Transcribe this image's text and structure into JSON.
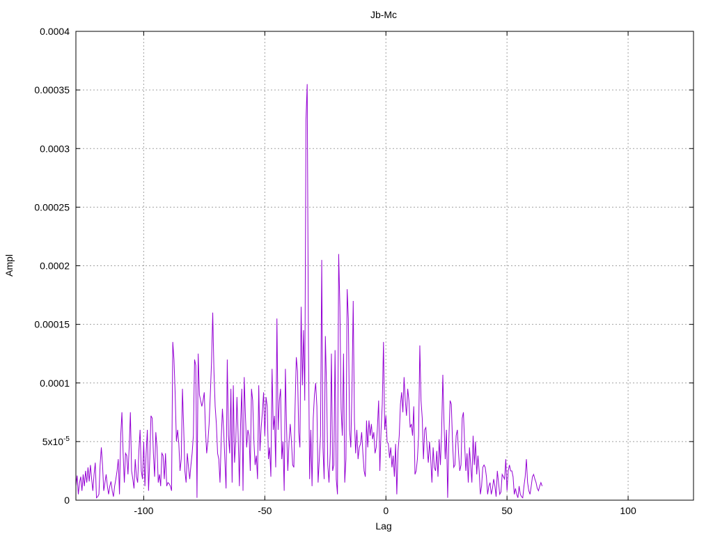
{
  "chart_data": {
    "type": "line",
    "title": "Jb-Mc",
    "xlabel": "Lag",
    "ylabel": "Ampl",
    "xlim": [
      -128,
      127
    ],
    "ylim": [
      0,
      0.0004
    ],
    "grid": true,
    "x_ticks": [
      {
        "value": -100,
        "label": "-100"
      },
      {
        "value": -50,
        "label": "-50"
      },
      {
        "value": 0,
        "label": "0"
      },
      {
        "value": 50,
        "label": "50"
      },
      {
        "value": 100,
        "label": "100"
      }
    ],
    "y_ticks": [
      {
        "value": 0,
        "label": "0"
      },
      {
        "value": 5e-05,
        "label": "5x10",
        "sup": "-5"
      },
      {
        "value": 0.0001,
        "label": "0.0001"
      },
      {
        "value": 0.00015,
        "label": "0.00015"
      },
      {
        "value": 0.0002,
        "label": "0.0002"
      },
      {
        "value": 0.00025,
        "label": "0.00025"
      },
      {
        "value": 0.0003,
        "label": "0.0003"
      },
      {
        "value": 0.00035,
        "label": "0.00035"
      },
      {
        "value": 0.0004,
        "label": "0.0004"
      }
    ],
    "series": [
      {
        "color": "#9400d3",
        "x_start": -128,
        "x_step": 0.5,
        "values": [
          1.2e-05,
          2.1e-05,
          5e-06,
          1.5e-05,
          2e-05,
          8e-06,
          2.2e-05,
          1.2e-05,
          2.5e-05,
          1.5e-05,
          2.8e-05,
          1.6e-05,
          3e-05,
          1.8e-05,
          8e-06,
          2.2e-05,
          3.2e-05,
          2e-06,
          3e-06,
          5e-06,
          3e-05,
          4.5e-05,
          3e-05,
          8e-06,
          1.5e-05,
          2.2e-05,
          1.2e-05,
          5e-06,
          1.2e-05,
          1.6e-05,
          8e-06,
          3e-06,
          1.2e-05,
          1.8e-05,
          2.5e-05,
          3.5e-05,
          5e-06,
          5.5e-05,
          7.5e-05,
          4e-05,
          1.5e-05,
          4e-05,
          3.8e-05,
          2.2e-05,
          4.5e-05,
          7.5e-05,
          2.5e-05,
          1.8e-05,
          1e-05,
          3.5e-05,
          2e-05,
          1.5e-05,
          4.2e-05,
          6e-05,
          2.5e-05,
          1.8e-05,
          5e-05,
          1.2e-05,
          4e-05,
          6e-05,
          8e-06,
          3.5e-05,
          7.2e-05,
          7e-05,
          4e-05,
          2e-05,
          5.8e-05,
          4.5e-05,
          1.5e-05,
          2.2e-05,
          1.2e-05,
          4e-05,
          3.8e-05,
          1.8e-05,
          4e-05,
          1.2e-05,
          1.5e-05,
          1.4e-05,
          1.2e-05,
          8e-06,
          0.000135,
          0.00012,
          9e-05,
          5e-05,
          6e-05,
          4.8e-05,
          2.5e-05,
          3.5e-05,
          9.5e-05,
          6.2e-05,
          2.5e-05,
          1.5e-05,
          4e-05,
          2.8e-05,
          1.8e-05,
          3e-05,
          4e-05,
          5.5e-05,
          0.00012,
          0.000115,
          2e-06,
          0.000125,
          9e-05,
          8.5e-05,
          8e-05,
          8.5e-05,
          9.2e-05,
          6e-05,
          4e-05,
          5e-05,
          6.5e-05,
          9e-05,
          0.000118,
          0.00016,
          0.00011,
          8e-05,
          6.5e-05,
          4e-05,
          3.5e-05,
          1.5e-05,
          5.2e-05,
          7.8e-05,
          6e-05,
          3.5e-05,
          1e-05,
          0.00012,
          5.5e-05,
          4e-05,
          9.5e-05,
          1.5e-05,
          9.8e-05,
          3.2e-05,
          5e-05,
          8.8e-05,
          5.5e-05,
          1.2e-05,
          6.5e-05,
          9.5e-05,
          8e-06,
          0.000105,
          7.2e-05,
          4.5e-05,
          6e-05,
          5.5e-05,
          2.5e-05,
          9.5e-05,
          8.5e-05,
          5e-05,
          3e-05,
          3.8e-05,
          1.8e-05,
          9.8e-05,
          4.2e-05,
          6.2e-05,
          7.5e-05,
          9.2e-05,
          5.5e-05,
          8.8e-05,
          8e-05,
          3.5e-05,
          4.5e-05,
          2e-05,
          0.000112,
          6e-05,
          7.2e-05,
          2.8e-05,
          0.000155,
          6e-05,
          8.5e-05,
          9.5e-05,
          3.5e-05,
          5e-05,
          8e-06,
          0.000112,
          6e-05,
          2.5e-05,
          5e-05,
          6.5e-05,
          5e-05,
          3e-05,
          2.8e-05,
          8e-05,
          0.000122,
          0.00011,
          5.8e-05,
          4.5e-05,
          0.000165,
          9.8e-05,
          0.000145,
          8.5e-05,
          0.000325,
          0.000355,
          0.00014,
          1.8e-05,
          6e-05,
          1.2e-05,
          7e-05,
          9e-05,
          0.0001,
          8e-05,
          1.5e-05,
          3.5e-05,
          5.5e-05,
          0.000205,
          4.5e-05,
          1.8e-05,
          0.00014,
          9.5e-05,
          3e-05,
          1.5e-05,
          4e-05,
          0.000125,
          2.5e-05,
          3e-05,
          0.000128,
          1.8e-05,
          5e-06,
          0.00021,
          0.000165,
          7.8e-05,
          5.5e-05,
          0.000125,
          1.5e-05,
          3.5e-05,
          0.00018,
          0.000155,
          6e-05,
          4.5e-05,
          9.5e-05,
          0.00017,
          6.8e-05,
          4e-05,
          6e-05,
          3.5e-05,
          4.5e-05,
          4.8e-05,
          5.8e-05,
          4e-05,
          2.5e-05,
          2e-05,
          6.8e-05,
          4.5e-05,
          6.8e-05,
          5.5e-05,
          6.5e-05,
          5.2e-05,
          5.8e-05,
          4e-05,
          4.5e-05,
          6.2e-05,
          8.5e-05,
          2.5e-05,
          6e-05,
          8.2e-05,
          0.000135,
          6e-05,
          7.2e-05,
          5e-05,
          4.8e-05,
          3.6e-05,
          4.5e-05,
          2.8e-05,
          3.8e-05,
          2e-05,
          4.8e-05,
          5e-06,
          4.2e-05,
          5.5e-05,
          8.2e-05,
          9.2e-05,
          7.5e-05,
          0.000105,
          8.5e-05,
          7.2e-05,
          9.5e-05,
          8.5e-05,
          6.2e-05,
          6.5e-05,
          5.5e-05,
          8e-05,
          2.2e-05,
          2.5e-05,
          3.5e-05,
          5.5e-05,
          0.000132,
          8.5e-05,
          7e-05,
          3.5e-05,
          6e-05,
          6.2e-05,
          4.5e-05,
          3.2e-05,
          5e-05,
          3.5e-05,
          1.5e-05,
          4.5e-05,
          2.8e-05,
          2.5e-05,
          4.2e-05,
          2e-05,
          5.2e-05,
          3e-05,
          5.8e-05,
          0.000107,
          6.5e-05,
          3.5e-05,
          6e-05,
          2e-06,
          5.2e-05,
          8.5e-05,
          8.2e-05,
          5e-05,
          2.8e-05,
          3e-05,
          5.5e-05,
          6e-05,
          4e-05,
          2.5e-05,
          3e-05,
          7e-05,
          7.5e-05,
          4.8e-05,
          2.5e-05,
          4e-05,
          1.5e-05,
          4.5e-05,
          3e-05,
          1.5e-05,
          5.5e-05,
          3e-05,
          5e-05,
          2.2e-05,
          3.8e-05,
          2.5e-05,
          5e-06,
          1.2e-05,
          2.8e-05,
          3e-05,
          2.8e-05,
          2e-05,
          5e-06,
          1.2e-05,
          1.5e-05,
          5e-06,
          1e-05,
          1.8e-05,
          1.2e-05,
          3e-06,
          2.5e-05,
          1.5e-05,
          5e-06,
          7e-06,
          2.2e-05,
          2e-05,
          1.8e-05,
          3.5e-05,
          8e-06,
          2.5e-05,
          3e-05,
          2.5e-05,
          2.5e-05,
          2e-05,
          5e-06,
          1e-05,
          5e-06,
          2e-06,
          1.2e-05,
          5e-06,
          3e-06,
          2e-06,
          1.2e-05,
          2e-05,
          3.5e-05,
          1.5e-05,
          8e-06,
          5e-06,
          1.2e-05,
          2e-05,
          2.2e-05,
          1.8e-05,
          1.5e-05,
          1e-05,
          8e-06,
          1.2e-05,
          1.5e-05,
          1.2e-05
        ]
      }
    ]
  }
}
